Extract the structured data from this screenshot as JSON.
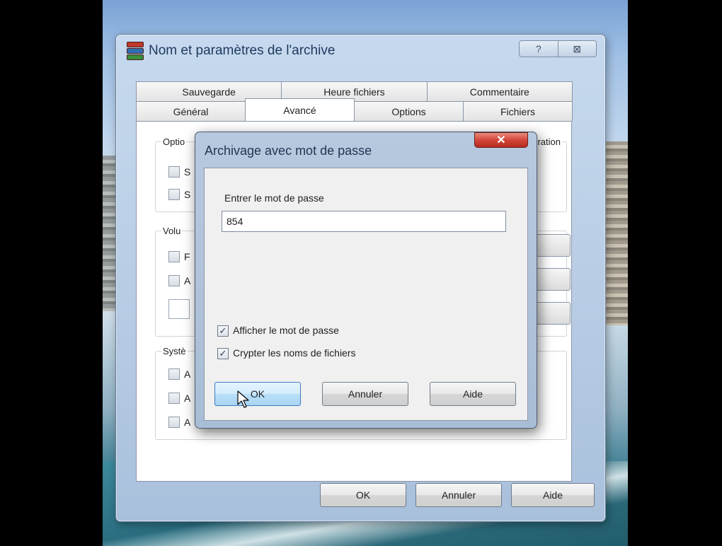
{
  "main_window": {
    "title": "Nom et paramètres de l'archive",
    "help_icon": "?",
    "close_icon": "⊠",
    "tabs_row1": [
      "Sauvegarde",
      "Heure fichiers",
      "Commentaire"
    ],
    "tabs_row2": [
      "Général",
      "Avancé",
      "Options",
      "Fichiers"
    ],
    "active_tab": "Avancé",
    "groups": {
      "options_label": "Optio",
      "options_right_label": "ration",
      "volumes_label": "Volu",
      "system_label": "Systè"
    },
    "partial_labels": [
      "S",
      "S",
      "F",
      "A",
      "A",
      "A",
      "A"
    ],
    "buttons": {
      "ok": "OK",
      "cancel": "Annuler",
      "help": "Aide"
    }
  },
  "password_dialog": {
    "title": "Archivage avec mot de passe",
    "close_icon": "✕",
    "prompt_label": "Entrer le mot de passe",
    "password_value": "854",
    "show_password": {
      "label": "Afficher le mot de passe",
      "checked": true
    },
    "encrypt_filenames": {
      "label": "Crypter les noms de fichiers",
      "checked": true
    },
    "buttons": {
      "ok": "OK",
      "cancel": "Annuler",
      "help": "Aide"
    },
    "check_glyph": "✓"
  }
}
